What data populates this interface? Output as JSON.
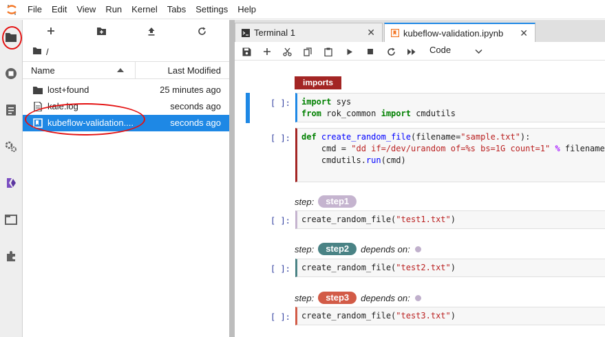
{
  "menubar": {
    "items": [
      "File",
      "Edit",
      "View",
      "Run",
      "Kernel",
      "Tabs",
      "Settings",
      "Help"
    ]
  },
  "leftbar": {
    "icons": [
      "folder-icon",
      "running-icon",
      "commands-icon",
      "property-inspector-icon",
      "kubeflow-kale-icon",
      "tabs-icon",
      "extensions-icon"
    ]
  },
  "filebrowser": {
    "breadcrumb": "/",
    "columns": {
      "name": "Name",
      "modified": "Last Modified"
    },
    "files": [
      {
        "name": "lost+found",
        "modified": "25 minutes ago",
        "type": "folder"
      },
      {
        "name": "kale.log",
        "modified": "seconds ago",
        "type": "file"
      },
      {
        "name": "kubeflow-validation....",
        "modified": "seconds ago",
        "type": "notebook"
      }
    ]
  },
  "tabs": [
    {
      "label": "Terminal 1"
    },
    {
      "label": "kubeflow-validation.ipynb"
    }
  ],
  "notebook": {
    "cell_type": "Code",
    "cells": [
      {
        "prompt": "[ ]:"
      },
      {
        "prompt": "[ ]:"
      },
      {
        "prompt": "[ ]:"
      },
      {
        "prompt": "[ ]:"
      },
      {
        "prompt": "[ ]:"
      }
    ],
    "tags": {
      "imports": "imports"
    },
    "steps": [
      {
        "prefix": "step:",
        "name": "step1",
        "color": "#c5b4cf"
      },
      {
        "prefix": "step:",
        "name": "step2",
        "depends": "depends on:",
        "color": "#4a8385"
      },
      {
        "prefix": "step:",
        "name": "step3",
        "depends": "depends on:",
        "color": "#d25b47"
      }
    ]
  },
  "colors": {
    "accent": "#1e88e5",
    "annotation": "#e41111",
    "imports_tag": "#a32524"
  }
}
